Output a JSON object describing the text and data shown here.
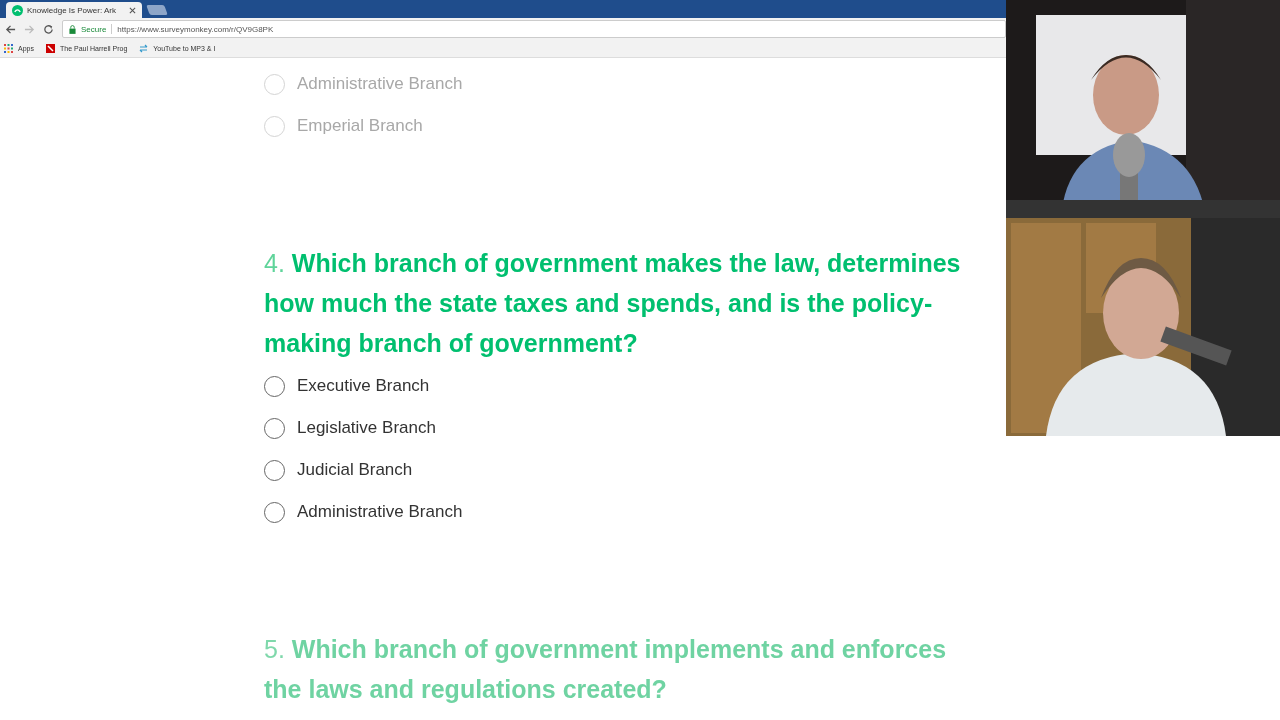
{
  "browser": {
    "tab_title": "Knowledge Is Power: Ark",
    "secure_label": "Secure",
    "url": "https://www.surveymonkey.com/r/QV9G8PK",
    "bookmarks": [
      {
        "kind": "apps",
        "label": "Apps"
      },
      {
        "kind": "page",
        "label": "The Paul Harrell Prog"
      },
      {
        "kind": "link",
        "label": "YouTube to MP3 & I"
      }
    ]
  },
  "questions": [
    {
      "faded": true,
      "options": [
        {
          "label": "Administrative Branch",
          "selected": false
        },
        {
          "label": "Emperial Branch",
          "selected": false
        }
      ]
    },
    {
      "faded": false,
      "number": "4.",
      "text": "Which branch of government makes the law, determines how much the state taxes and spends, and is the policy-making branch of government?",
      "options": [
        {
          "label": "Executive Branch",
          "selected": false
        },
        {
          "label": "Legislative Branch",
          "selected": false
        },
        {
          "label": "Judicial Branch",
          "selected": false
        },
        {
          "label": "Administrative Branch",
          "selected": false
        }
      ]
    },
    {
      "faded": true,
      "number": "5.",
      "text": "Which branch of government implements and enforces the laws and regulations created?"
    }
  ]
}
